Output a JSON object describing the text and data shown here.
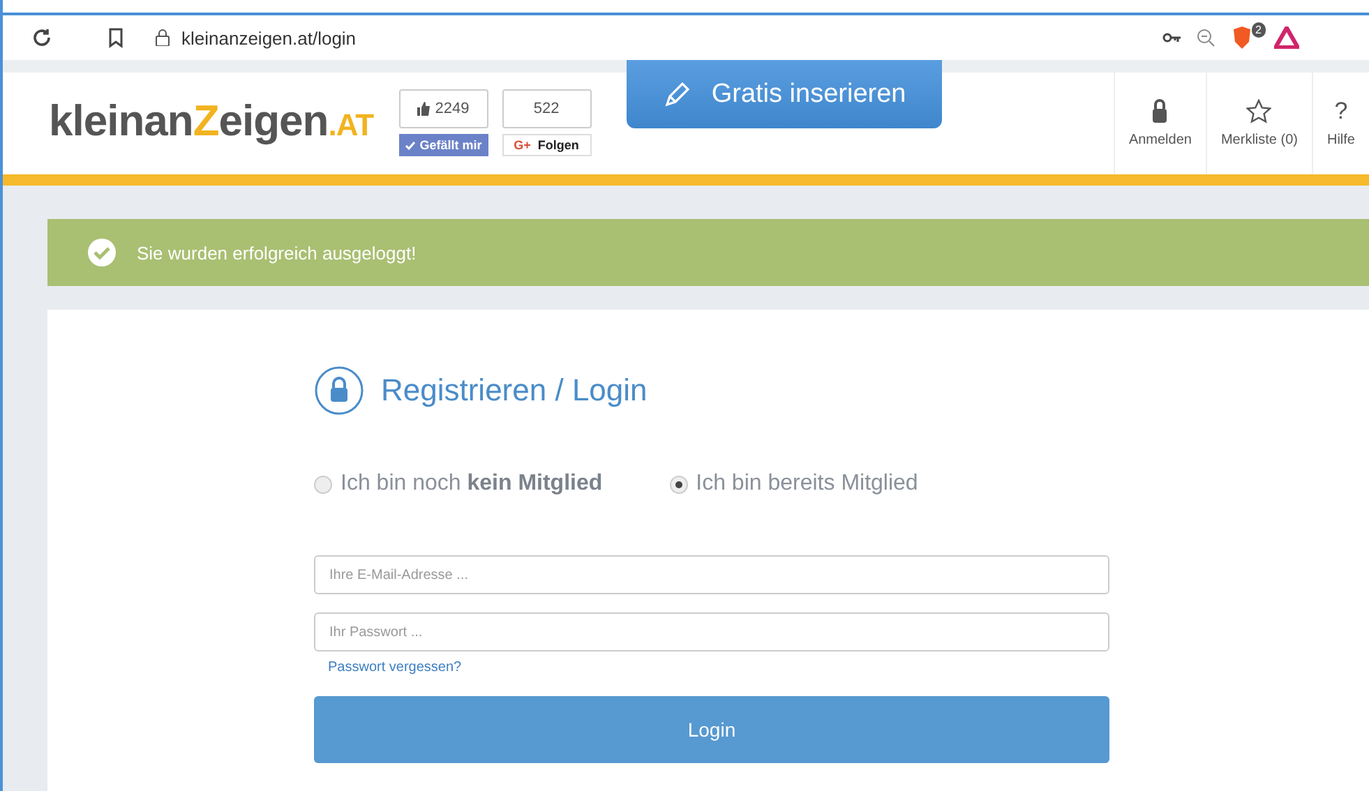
{
  "browser": {
    "url": "kleinanzeigen.at/login",
    "shield_badge": "2"
  },
  "header": {
    "logo": [
      {
        "text": "kleinan",
        "accent": false
      },
      {
        "text": "Z",
        "accent": true
      },
      {
        "text": "eigen",
        "accent": false
      },
      {
        "text": ".AT",
        "accent": true
      }
    ],
    "social": [
      {
        "kind": "facebook",
        "count": "2249",
        "action": "Gefällt mir"
      },
      {
        "kind": "google",
        "count": "522",
        "glyph": "G+",
        "action": "Folgen"
      }
    ],
    "post_button": "Gratis inserieren",
    "nav": [
      {
        "kind": "lock",
        "label": "Anmelden"
      },
      {
        "kind": "star",
        "label": "Merkliste (0)"
      },
      {
        "kind": "help",
        "glyph": "?",
        "label": "Hilfe"
      }
    ]
  },
  "banner": {
    "message": "Sie wurden erfolgreich ausgeloggt!"
  },
  "login": {
    "title": "Registrieren / Login",
    "options": [
      {
        "label": "Ich bin noch **kein Mitglied**",
        "selected": false
      },
      {
        "label": "Ich bin bereits Mitglied",
        "selected": true
      }
    ],
    "email": {
      "placeholder": "Ihre E-Mail-Adresse ..."
    },
    "password": {
      "placeholder": "Ihr Passwort ..."
    },
    "forgot_link": "Passwort vergessen?",
    "submit": "Login"
  }
}
